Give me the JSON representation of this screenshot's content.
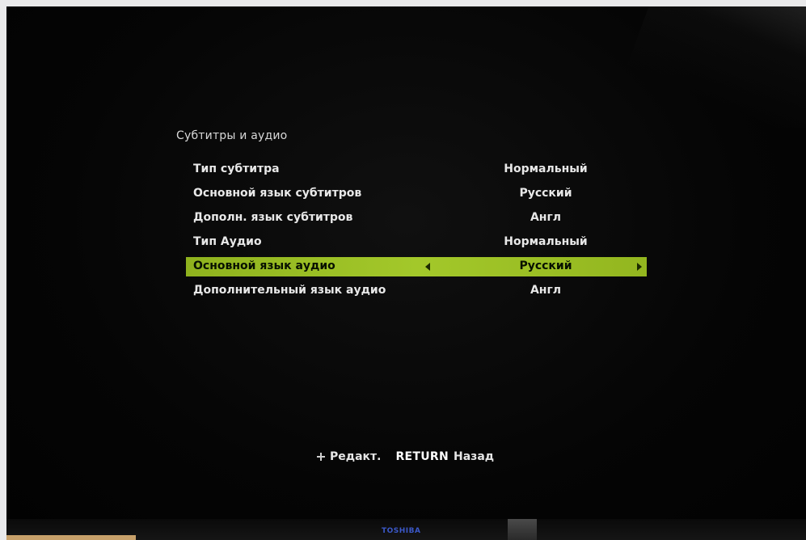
{
  "menu": {
    "title": "Субтитры и аудио",
    "items": [
      {
        "label": "Тип субтитра",
        "value": "Нормальный"
      },
      {
        "label": "Основной язык субтитров",
        "value": "Русский"
      },
      {
        "label": "Дополн. язык субтитров",
        "value": "Англ"
      },
      {
        "label": "Тип Аудио",
        "value": "Нормальный"
      },
      {
        "label": "Основной язык аудио",
        "value": "Русский",
        "selected": true
      },
      {
        "label": "Дополнительный язык аудио",
        "value": "Англ"
      }
    ]
  },
  "footer": {
    "edit_label": "Редакт.",
    "return_key": "RETURN",
    "return_label": "Назад"
  },
  "brand": "TOSHIBA",
  "colors": {
    "highlight": "#a3c82a",
    "background": "#050505",
    "brand": "#3b58c8"
  },
  "icons": {
    "dpad": "dpad-icon",
    "left": "arrow-left-icon",
    "right": "arrow-right-icon"
  }
}
